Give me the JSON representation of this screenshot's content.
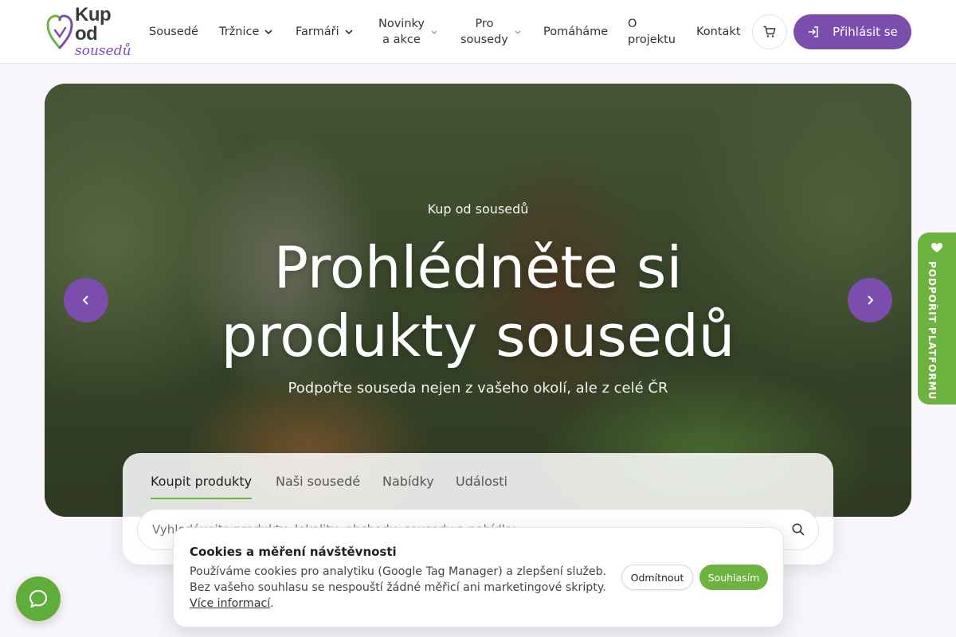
{
  "brand": {
    "line1": "Kup od",
    "line2": "sousedů",
    "accent_color": "#7b4dac",
    "green_color": "#6cb33f"
  },
  "nav": {
    "items": [
      {
        "label": "Sousedé"
      },
      {
        "label": "Tržnice",
        "dropdown": true
      },
      {
        "label": "Farmáři",
        "dropdown": true
      },
      {
        "label_line1": "Novinky",
        "label_line2": "a akce",
        "dropdown": true
      },
      {
        "label_line1": "Pro",
        "label_line2": "sousedy",
        "dropdown": true
      },
      {
        "label": "Pomáháme"
      },
      {
        "label_line1": "O",
        "label_line2": "projektu"
      },
      {
        "label": "Kontakt"
      }
    ],
    "cart_icon": "cart-icon",
    "login_label": "Přihlásit se",
    "login_icon": "login-icon"
  },
  "hero": {
    "eyebrow": "Kup od sousedů",
    "title_line1": "Prohlédněte si",
    "title_line2": "produkty sousedů",
    "subtitle": "Podpořte souseda nejen z vašeho okolí, ale z celé ČR",
    "prev_icon": "chevron-left-icon",
    "next_icon": "chevron-right-icon"
  },
  "search": {
    "tabs": [
      {
        "label": "Koupit produkty",
        "active": true
      },
      {
        "label": "Naši sousedé",
        "active": false
      },
      {
        "label": "Nabídky",
        "active": false
      },
      {
        "label": "Události",
        "active": false
      }
    ],
    "placeholder": "Vyhledávejte produkty, lokality, obchody, sousedy a nabídky",
    "icon": "search-icon"
  },
  "support_tab": {
    "label": "PODPOŘIT PLATFORMU",
    "icon": "heart-icon"
  },
  "cookies": {
    "title": "Cookies a měření návštěvnosti",
    "text": "Používáme cookies pro analytiku (Google Tag Manager) a zlepšení služeb. Bez vašeho souhlasu se nespouští žádné měřicí ani marketingové skripty.",
    "link": "Více informací",
    "link_suffix": ".",
    "decline_label": "Odmítnout",
    "accept_label": "Souhlasím"
  },
  "chat": {
    "icon": "chat-bubble-icon"
  }
}
